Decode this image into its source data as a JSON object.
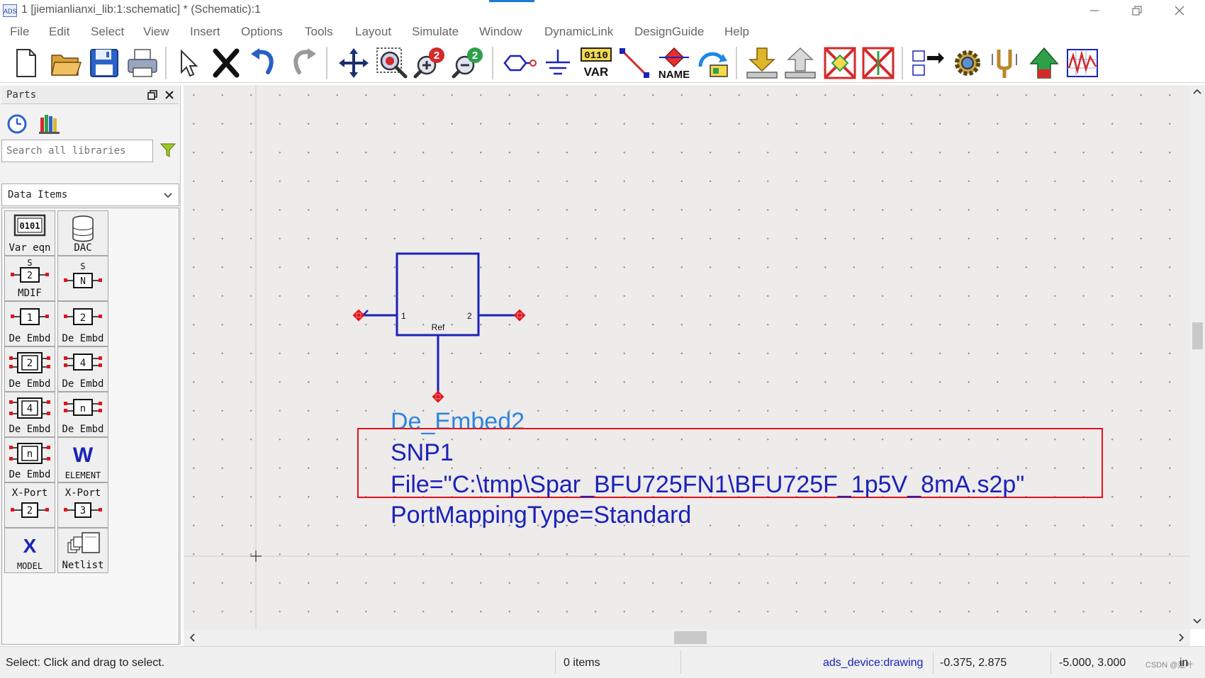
{
  "window": {
    "title": "1 [jiemianlianxi_lib:1:schematic] * (Schematic):1",
    "app_icon_text": "ADS",
    "minimize_icon": "minimize-icon",
    "restore_icon": "restore-icon",
    "close_icon": "close-icon"
  },
  "menu": [
    "File",
    "Edit",
    "Select",
    "View",
    "Insert",
    "Options",
    "Tools",
    "Layout",
    "Simulate",
    "Window",
    "DynamicLink",
    "DesignGuide",
    "Help"
  ],
  "toolbar": {
    "var_label": "VAR",
    "var_digits": "0110",
    "name_label": "NAME",
    "zoom_badge": "2"
  },
  "parts_panel": {
    "title": "Parts",
    "search_placeholder": "Search all libraries",
    "library": "Data Items",
    "items": [
      {
        "label": "Var eqn",
        "glyph": "0101"
      },
      {
        "label": "DAC",
        "glyph": "DAC"
      },
      {
        "label": "MDIF",
        "glyph": "2"
      },
      {
        "label": "",
        "glyph": "N"
      },
      {
        "label": "De Embd",
        "glyph": "1"
      },
      {
        "label": "De Embd",
        "glyph": "2"
      },
      {
        "label": "De Embd",
        "glyph": "2"
      },
      {
        "label": "De Embd",
        "glyph": "4"
      },
      {
        "label": "De Embd",
        "glyph": "4"
      },
      {
        "label": "De Embd",
        "glyph": "n"
      },
      {
        "label": "De Embd",
        "glyph": "n"
      },
      {
        "label": "ELEMENT",
        "glyph": "W"
      },
      {
        "label": "X-Port",
        "glyph": "2"
      },
      {
        "label": "X-Port",
        "glyph": "3"
      },
      {
        "label": "MODEL",
        "glyph": "X"
      },
      {
        "label": "Netlist",
        "glyph": ""
      }
    ],
    "s_letter": "S"
  },
  "schematic": {
    "port1": "1",
    "port2": "2",
    "ref": "Ref",
    "component": "De_Embed2",
    "instance": "SNP1",
    "file_param": "File=\"C:\\tmp\\Spar_BFU725FN1\\BFU725F_1p5V_8mA.s2p\"",
    "mapping_param": "PortMappingType=Standard"
  },
  "status": {
    "message": "Select: Click and drag to select.",
    "items": "0 items",
    "layer": "ads_device:drawing",
    "coord1": "-0.375, 2.875",
    "coord2": "-5.000, 3.000",
    "unit": "in",
    "watermark": "CSDN @是叶"
  },
  "colors": {
    "schematic_blue": "#1b22b8",
    "label_blue": "#2e86de",
    "pin_red": "#e0141c",
    "highlight_red": "#e0141c",
    "canvas_bg": "#eeebeb"
  }
}
